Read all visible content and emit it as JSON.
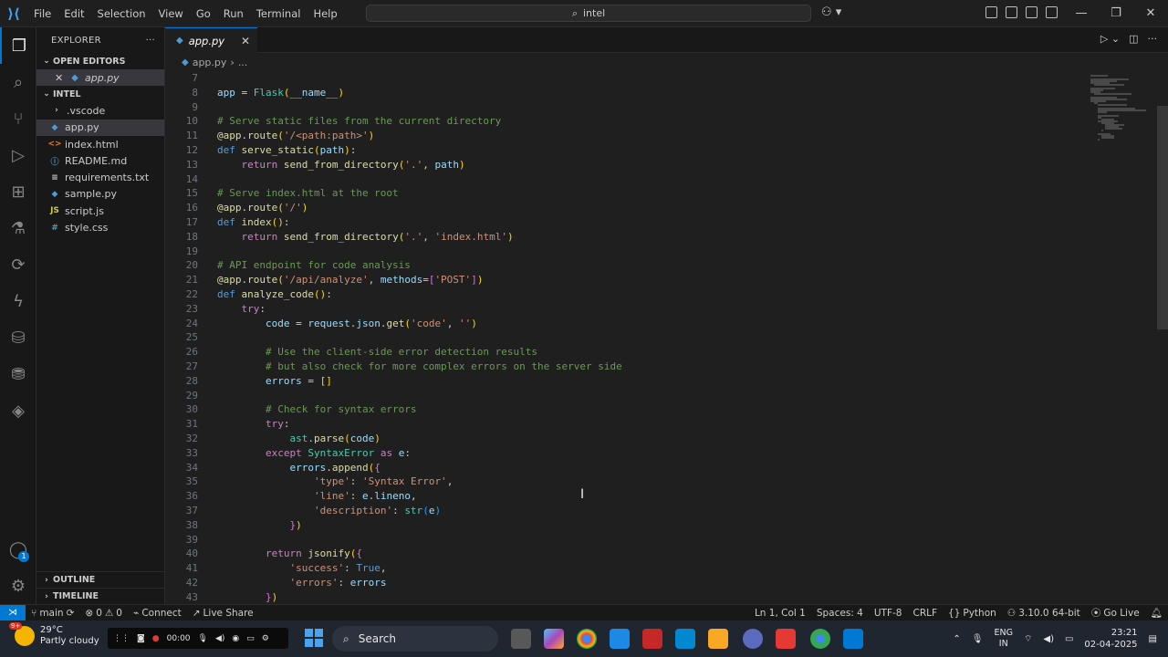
{
  "titlebar": {
    "menu": [
      "File",
      "Edit",
      "Selection",
      "View",
      "Go",
      "Run",
      "Terminal",
      "Help"
    ],
    "search_text": "intel"
  },
  "explorer": {
    "title": "EXPLORER",
    "open_editors_label": "OPEN EDITORS",
    "open_editor_file": "app.py",
    "folder_label": "INTEL",
    "items": [
      {
        "name": ".vscode",
        "icon": "folder-chevron",
        "color": "#cccccc"
      },
      {
        "name": "app.py",
        "icon": "python-icon",
        "color": "#4d9ad5"
      },
      {
        "name": "index.html",
        "icon": "html-icon",
        "color": "#e37933"
      },
      {
        "name": "README.md",
        "icon": "info-icon",
        "color": "#519aba"
      },
      {
        "name": "requirements.txt",
        "icon": "lines-icon",
        "color": "#cccccc"
      },
      {
        "name": "sample.py",
        "icon": "python-icon",
        "color": "#4d9ad5"
      },
      {
        "name": "script.js",
        "icon": "js-icon",
        "color": "#cbcb41"
      },
      {
        "name": "style.css",
        "icon": "css-icon",
        "color": "#519aba"
      }
    ],
    "outline_label": "OUTLINE",
    "timeline_label": "TIMELINE"
  },
  "editor": {
    "tab_label": "app.py",
    "breadcrumb_file": "app.py",
    "breadcrumb_more": "...",
    "lines": [
      {
        "n": "7",
        "html": ""
      },
      {
        "n": "8",
        "html": "<span class='var'>app</span> = <span class='cls'>Flask</span><span class='br'>(</span><span class='var'>__name__</span><span class='br'>)</span>"
      },
      {
        "n": "9",
        "html": ""
      },
      {
        "n": "10",
        "html": "<span class='cm'># Serve static files from the current directory</span>"
      },
      {
        "n": "11",
        "html": "<span class='dec'>@app.route</span><span class='br'>(</span><span class='str'>'/&lt;path:path&gt;'</span><span class='br'>)</span>"
      },
      {
        "n": "12",
        "html": "<span class='kw2'>def</span> <span class='fn'>serve_static</span><span class='br'>(</span><span class='var'>path</span><span class='br'>)</span>:"
      },
      {
        "n": "13",
        "html": "    <span class='kw'>return</span> <span class='fn'>send_from_directory</span><span class='br'>(</span><span class='str'>'.'</span>, <span class='var'>path</span><span class='br'>)</span>"
      },
      {
        "n": "14",
        "html": ""
      },
      {
        "n": "15",
        "html": "<span class='cm'># Serve index.html at the root</span>"
      },
      {
        "n": "16",
        "html": "<span class='dec'>@app.route</span><span class='br'>(</span><span class='str'>'/'</span><span class='br'>)</span>"
      },
      {
        "n": "17",
        "html": "<span class='kw2'>def</span> <span class='fn'>index</span><span class='br'>()</span>:"
      },
      {
        "n": "18",
        "html": "    <span class='kw'>return</span> <span class='fn'>send_from_directory</span><span class='br'>(</span><span class='str'>'.'</span>, <span class='str'>'index.html'</span><span class='br'>)</span>"
      },
      {
        "n": "19",
        "html": ""
      },
      {
        "n": "20",
        "html": "<span class='cm'># API endpoint for code analysis</span>"
      },
      {
        "n": "21",
        "html": "<span class='dec'>@app.route</span><span class='br'>(</span><span class='str'>'/api/analyze'</span>, <span class='var'>methods</span>=<span class='br2'>[</span><span class='str'>'POST'</span><span class='br2'>]</span><span class='br'>)</span>"
      },
      {
        "n": "22",
        "html": "<span class='kw2'>def</span> <span class='fn'>analyze_code</span><span class='br'>()</span>:"
      },
      {
        "n": "23",
        "html": "    <span class='kw'>try</span>:"
      },
      {
        "n": "24",
        "html": "        <span class='var'>code</span> = <span class='var'>request</span>.<span class='var'>json</span>.<span class='fn'>get</span><span class='br'>(</span><span class='str'>'code'</span>, <span class='str'>''</span><span class='br'>)</span>"
      },
      {
        "n": "25",
        "html": ""
      },
      {
        "n": "26",
        "html": "        <span class='cm'># Use the client-side error detection results</span>"
      },
      {
        "n": "27",
        "html": "        <span class='cm'># but also check for more complex errors on the server side</span>"
      },
      {
        "n": "28",
        "html": "        <span class='var'>errors</span> = <span class='br'>[]</span>"
      },
      {
        "n": "29",
        "html": ""
      },
      {
        "n": "30",
        "html": "        <span class='cm'># Check for syntax errors</span>"
      },
      {
        "n": "31",
        "html": "        <span class='kw'>try</span>:"
      },
      {
        "n": "32",
        "html": "            <span class='cls'>ast</span>.<span class='fn'>parse</span><span class='br'>(</span><span class='var'>code</span><span class='br'>)</span>"
      },
      {
        "n": "33",
        "html": "        <span class='kw'>except</span> <span class='cls'>SyntaxError</span> <span class='kw'>as</span> <span class='var'>e</span>:"
      },
      {
        "n": "34",
        "html": "            <span class='var'>errors</span>.<span class='fn'>append</span><span class='br'>(</span><span class='br2'>{</span>"
      },
      {
        "n": "35",
        "html": "                <span class='str'>'type'</span>: <span class='str'>'Syntax Error'</span>,"
      },
      {
        "n": "36",
        "html": "                <span class='str'>'line'</span>: <span class='var'>e</span>.<span class='var'>lineno</span>,"
      },
      {
        "n": "37",
        "html": "                <span class='str'>'description'</span>: <span class='cls'>str</span><span class='br3'>(</span><span class='var'>e</span><span class='br3'>)</span>"
      },
      {
        "n": "38",
        "html": "            <span class='br2'>}</span><span class='br'>)</span>"
      },
      {
        "n": "39",
        "html": ""
      },
      {
        "n": "40",
        "html": "        <span class='kw'>return</span> <span class='fn'>jsonify</span><span class='br'>(</span><span class='br2'>{</span>"
      },
      {
        "n": "41",
        "html": "            <span class='str'>'success'</span>: <span class='kw2'>True</span>,"
      },
      {
        "n": "42",
        "html": "            <span class='str'>'errors'</span>: <span class='var'>errors</span>"
      },
      {
        "n": "43",
        "html": "        <span class='br2'>}</span><span class='br'>)</span>"
      }
    ]
  },
  "statusbar": {
    "branch": "main",
    "errors": "0",
    "warnings": "0",
    "connect": "Connect",
    "live_share": "Live Share",
    "position": "Ln 1, Col 1",
    "spaces": "Spaces: 4",
    "encoding": "UTF-8",
    "eol": "CRLF",
    "language": "Python",
    "interpreter": "3.10.0 64-bit",
    "go_live": "Go Live"
  },
  "taskbar": {
    "temperature": "29°C",
    "weather": "Partly cloudy",
    "weather_badge": "9+",
    "rec_time": "00:00",
    "search_label": "Search",
    "lang_top": "ENG",
    "lang_bottom": "IN",
    "time": "23:21",
    "date": "02-04-2025"
  }
}
